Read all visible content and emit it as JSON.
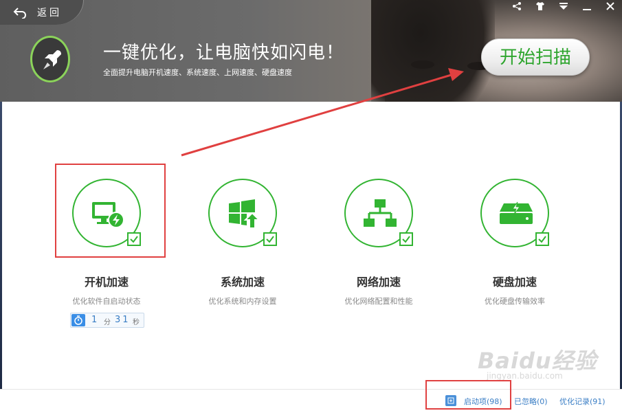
{
  "nav": {
    "back_label": "返回"
  },
  "window_controls": [
    "share-icon",
    "skin-icon",
    "menu-icon",
    "minimize-icon",
    "close-icon"
  ],
  "hero": {
    "headline": "一键优化，让电脑快如闪电！",
    "subline": "全面提升电脑开机速度、系统速度、上网速度、硬盘速度",
    "scan_button": "开始扫描"
  },
  "cards": [
    {
      "title": "开机加速",
      "desc": "优化软件自启动状态",
      "icon": "monitor-bolt-icon",
      "checked": true
    },
    {
      "title": "系统加速",
      "desc": "优化系统和内存设置",
      "icon": "windows-upgrade-icon",
      "checked": true
    },
    {
      "title": "网络加速",
      "desc": "优化网络配置和性能",
      "icon": "network-icon",
      "checked": true
    },
    {
      "title": "硬盘加速",
      "desc": "优化硬盘传输效率",
      "icon": "harddisk-bolt-icon",
      "checked": true
    }
  ],
  "timer": {
    "minutes": "1",
    "minute_unit": "分",
    "seconds": "31",
    "second_unit": "秒"
  },
  "footer": {
    "startup": "启动项(98)",
    "ignored": "已忽略(0)",
    "history": "优化记录(91)"
  },
  "watermark": {
    "text": "Baidu经验",
    "sub": "jingyan.baidu.com"
  },
  "colors": {
    "accent_green": "#32b432",
    "link_blue": "#3a7ec5",
    "annotation_red": "#e04040"
  }
}
